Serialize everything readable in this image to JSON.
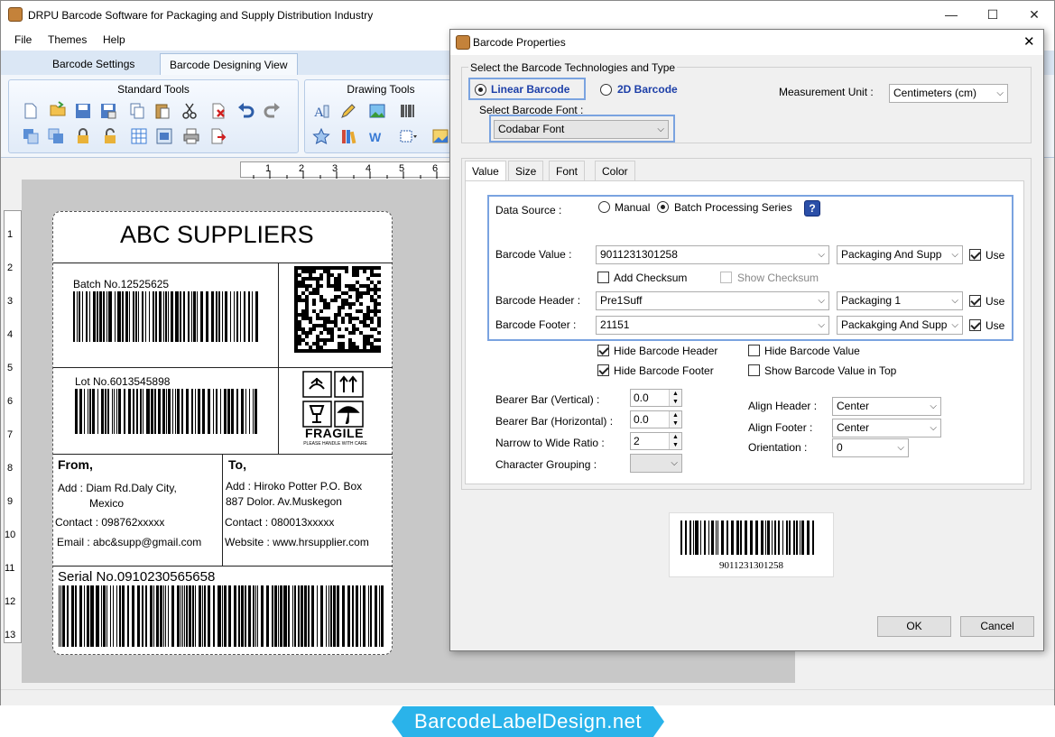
{
  "window": {
    "title": "DRPU Barcode Software for Packaging and Supply Distribution Industry"
  },
  "menu": [
    "File",
    "Themes",
    "Help"
  ],
  "tabs": [
    "Barcode Settings",
    "Barcode Designing View"
  ],
  "ribbon": {
    "standard_label": "Standard Tools",
    "drawing_label": "Drawing Tools"
  },
  "ruler": {
    "h": [
      "1",
      "2",
      "3",
      "4",
      "5",
      "6"
    ],
    "v": [
      "1",
      "2",
      "3",
      "4",
      "5",
      "6",
      "7",
      "8",
      "9",
      "10",
      "11",
      "12",
      "13"
    ]
  },
  "label": {
    "company": "ABC SUPPLIERS",
    "batch": "Batch No.12525625",
    "lot": "Lot No.6013545898",
    "fragile": "FRAGILE",
    "fragile_sub": "PLEASE HANDLE WITH CARE",
    "from_title": "From,",
    "from_addr1": "Add : Diam Rd.Daly City,",
    "from_addr2": "Mexico",
    "from_contact": "Contact : 098762xxxxx",
    "from_email": "Email : abc&supp@gmail.com",
    "to_title": "To,",
    "to_addr1": "Add : Hiroko Potter P.O. Box",
    "to_addr2": "887  Dolor. Av.Muskegon",
    "to_contact": "Contact : 080013xxxxx",
    "to_website": "Website : www.hrsupplier.com",
    "serial": "Serial No.0910230565658"
  },
  "dialog": {
    "title": "Barcode Properties",
    "tech_group": "Select the Barcode Technologies and Type",
    "linear": "Linear Barcode",
    "twod": "2D Barcode",
    "font_label": "Select Barcode Font :",
    "font_value": "Codabar Font",
    "unit_label": "Measurement Unit :",
    "unit_value": "Centimeters (cm)",
    "subtabs": [
      "Value",
      "Size",
      "Font",
      "Color"
    ],
    "data_source": "Data Source :",
    "manual": "Manual",
    "batch_series": "Batch Processing Series",
    "help_icon": "?",
    "barcode_value_label": "Barcode Value :",
    "barcode_value": "9011231301258",
    "barcode_value_src": "Packaging And Supp",
    "use": "Use",
    "add_checksum": "Add Checksum",
    "show_checksum": "Show Checksum",
    "header_label": "Barcode Header :",
    "header_value": "Pre1Suff",
    "header_src": "Packaging 1",
    "footer_label": "Barcode Footer :",
    "footer_value": "21151",
    "footer_src": "Packakging And Supp",
    "hide_header": "Hide Barcode Header",
    "hide_footer": "Hide Barcode Footer",
    "hide_value": "Hide Barcode Value",
    "show_value_top": "Show Barcode Value in Top",
    "bearer_v_label": "Bearer Bar (Vertical) :",
    "bearer_v": "0.0",
    "bearer_h_label": "Bearer Bar (Horizontal) :",
    "bearer_h": "0.0",
    "ratio_label": "Narrow to Wide Ratio :",
    "ratio": "2",
    "grouping_label": "Character Grouping :",
    "align_header_label": "Align Header :",
    "align_header": "Center",
    "align_footer_label": "Align Footer :",
    "align_footer": "Center",
    "orientation_label": "Orientation :",
    "orientation": "0",
    "preview_value": "9011231301258",
    "ok": "OK",
    "cancel": "Cancel"
  },
  "brand": "BarcodeLabelDesign.net"
}
